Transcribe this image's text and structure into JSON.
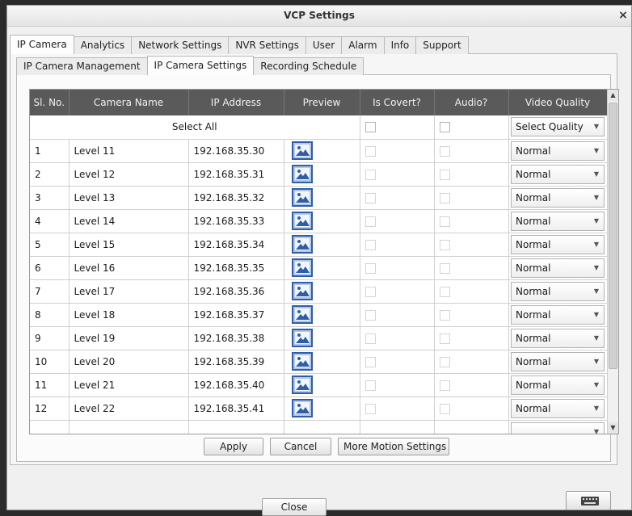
{
  "window": {
    "title": "VCP Settings",
    "close_glyph": "×"
  },
  "tabs": [
    "IP Camera",
    "Analytics",
    "Network Settings",
    "NVR Settings",
    "User",
    "Alarm",
    "Info",
    "Support"
  ],
  "subtabs": [
    "IP Camera Management",
    "IP Camera Settings",
    "Recording Schedule"
  ],
  "table": {
    "columns": [
      "Sl. No.",
      "Camera Name",
      "IP Address",
      "Preview",
      "Is Covert?",
      "Audio?",
      "Video Quality"
    ],
    "select_all_label": "Select All",
    "select_all_quality": "Select Quality",
    "rows": [
      {
        "sl": "1",
        "name": "Level 11",
        "ip": "192.168.35.30",
        "quality": "Normal"
      },
      {
        "sl": "2",
        "name": "Level 12",
        "ip": "192.168.35.31",
        "quality": "Normal"
      },
      {
        "sl": "3",
        "name": "Level 13",
        "ip": "192.168.35.32",
        "quality": "Normal"
      },
      {
        "sl": "4",
        "name": "Level 14",
        "ip": "192.168.35.33",
        "quality": "Normal"
      },
      {
        "sl": "5",
        "name": "Level 15",
        "ip": "192.168.35.34",
        "quality": "Normal"
      },
      {
        "sl": "6",
        "name": "Level 16",
        "ip": "192.168.35.35",
        "quality": "Normal"
      },
      {
        "sl": "7",
        "name": "Level 17",
        "ip": "192.168.35.36",
        "quality": "Normal"
      },
      {
        "sl": "8",
        "name": "Level 18",
        "ip": "192.168.35.37",
        "quality": "Normal"
      },
      {
        "sl": "9",
        "name": "Level 19",
        "ip": "192.168.35.38",
        "quality": "Normal"
      },
      {
        "sl": "10",
        "name": "Level 20",
        "ip": "192.168.35.39",
        "quality": "Normal"
      },
      {
        "sl": "11",
        "name": "Level 21",
        "ip": "192.168.35.40",
        "quality": "Normal"
      },
      {
        "sl": "12",
        "name": "Level 22",
        "ip": "192.168.35.41",
        "quality": "Normal"
      },
      {
        "sl": "",
        "name": "",
        "ip": "",
        "quality": ""
      }
    ]
  },
  "buttons": {
    "apply": "Apply",
    "cancel": "Cancel",
    "more_motion": "More Motion Settings",
    "close": "Close"
  },
  "icons": {
    "preview": "image-preview-icon",
    "keyboard": "keyboard-icon",
    "dropdown": "chevron-down-icon"
  },
  "colors": {
    "header_bg": "#5a5a5a",
    "preview_icon": "#2e5ea7"
  }
}
